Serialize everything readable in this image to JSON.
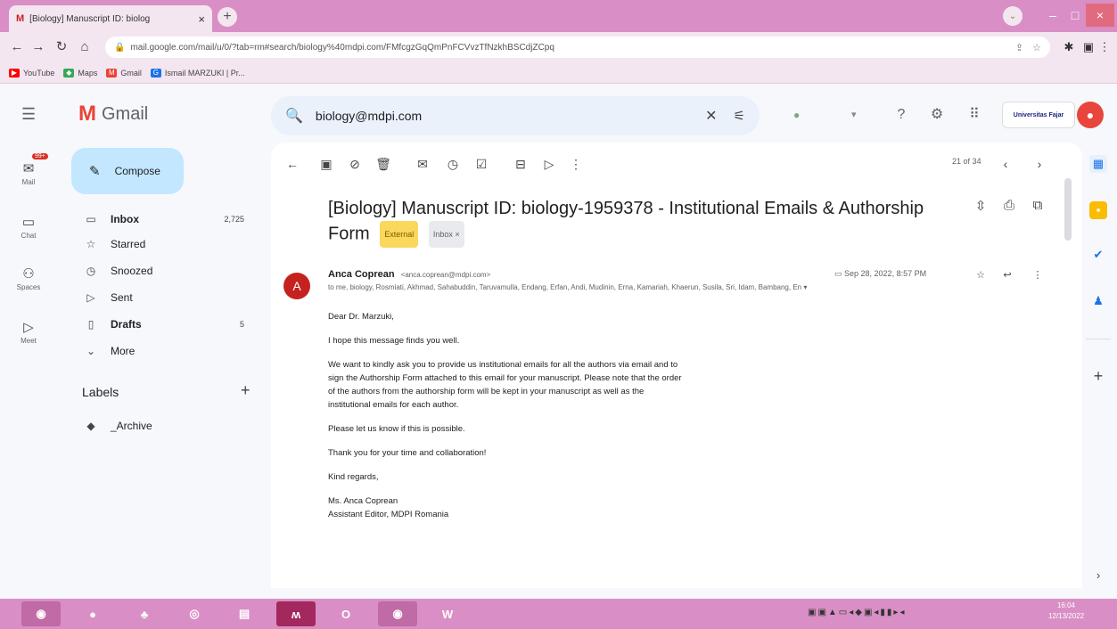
{
  "browser": {
    "tab_title": "[Biology] Manuscript ID: biolog",
    "tab_favicon": "M",
    "url": "mail.google.com/mail/u/0/?tab=rm#search/biology%40mdpi.com/FMfcgzGqQmPnFCVvzTfNzkhBSCdjZCpq",
    "bookmarks": [
      {
        "label": "YouTube",
        "color": "#ff0000"
      },
      {
        "label": "Maps",
        "color": "#34a853"
      },
      {
        "label": "Gmail",
        "color": "#ea4335"
      },
      {
        "label": "Ismail MARZUKI | Pr...",
        "color": "#1a73e8"
      }
    ]
  },
  "gmail": {
    "logo_text": "Gmail",
    "search_value": "biology@mdpi.com",
    "org_badge": "Universitas Fajar"
  },
  "rail": {
    "mail_label": "Mail",
    "mail_badge": "99+",
    "chat_label": "Chat",
    "spaces_label": "Spaces",
    "meet_label": "Meet"
  },
  "compose_label": "Compose",
  "nav": {
    "inbox": {
      "label": "Inbox",
      "count": "2,725"
    },
    "starred": {
      "label": "Starred"
    },
    "snoozed": {
      "label": "Snoozed"
    },
    "sent": {
      "label": "Sent"
    },
    "drafts": {
      "label": "Drafts",
      "count": "5"
    },
    "more": {
      "label": "More"
    }
  },
  "labels": {
    "header": "Labels",
    "items": [
      "_Archive"
    ]
  },
  "email": {
    "pager": "21 of 34",
    "subject": "[Biology] Manuscript ID: biology-1959378 - Institutional Emails & Authorship Form",
    "badge_external": "External",
    "badge_inbox": "Inbox ×",
    "sender_name": "Anca Coprean",
    "sender_email": "<anca.coprean@mdpi.com>",
    "sender_initial": "A",
    "recipients": "to me, biology, Rosmiati, Akhmad, Sahabuddin, Taruvamulla, Endang, Erfan, Andi, Mudinin, Erna, Kamariah, Khaerun, Susila, Sri, Idam, Bambang, En ▾",
    "date": "Sep 28, 2022, 8:57 PM",
    "greeting": "Dear Dr. Marzuki,",
    "p1": "I hope this message finds you well.",
    "p2": "We want to kindly ask you to provide us institutional emails for all the authors via email and to sign the Authorship Form attached to this email for your manuscript. Please note that the order of the authors from the authorship form will be kept in your manuscript as well as the institutional emails for each author.",
    "p3": "Please let us know if this is possible.",
    "p4": "Thank you for your time and collaboration!",
    "p5": "Kind regards,",
    "sig1": "Ms. Anca Coprean",
    "sig2": "Assistant Editor, MDPI Romania"
  },
  "taskbar": {
    "clock_time": "16:04",
    "clock_date": "12/13/2022"
  }
}
